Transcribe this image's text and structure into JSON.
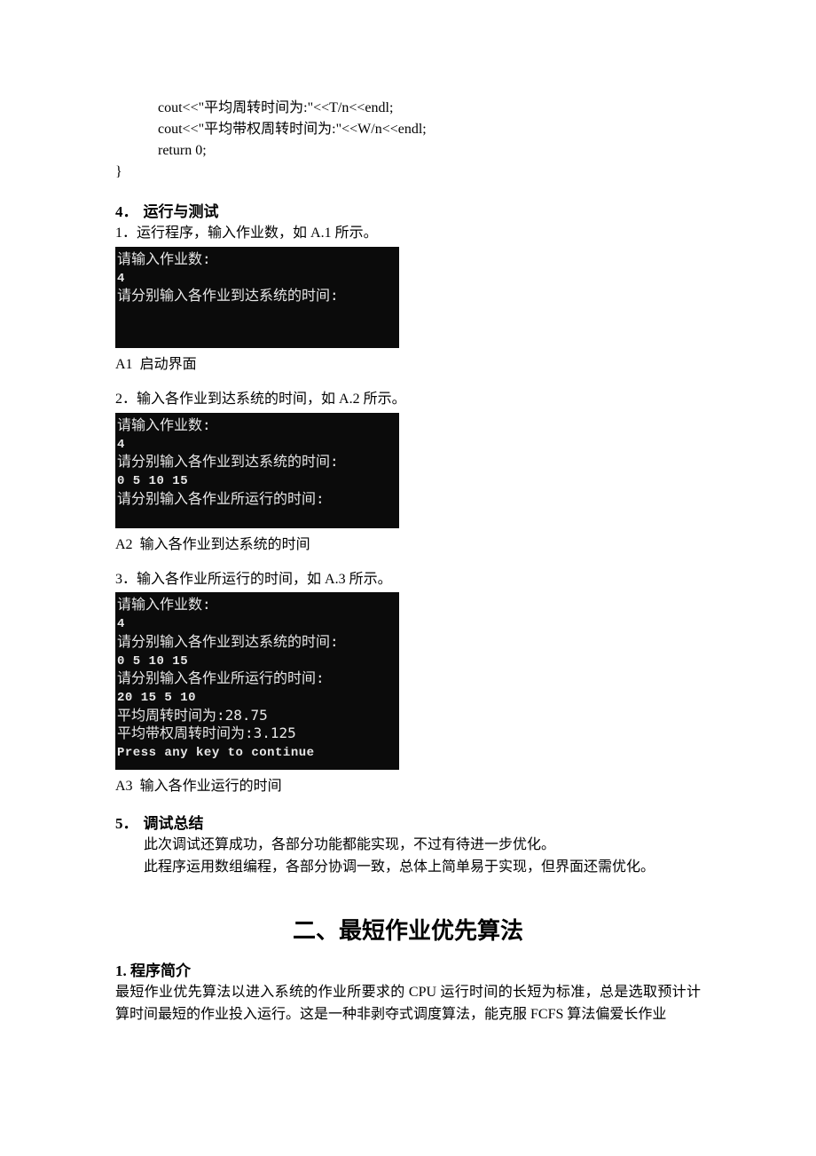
{
  "code": {
    "line1": "cout<<\"平均周转时间为:\"<<T/n<<endl;",
    "line2": "cout<<\"平均带权周转时间为:\"<<W/n<<endl;",
    "line3": "return 0;",
    "brace": "}"
  },
  "section4": {
    "heading_num": "4．",
    "heading": "运行与测试",
    "item1_num": "1．",
    "item1": "运行程序，输入作业数，如 A.1 所示。",
    "caption1_label": "A1",
    "caption1": "启动界面",
    "item2_num": "2．",
    "item2": "输入各作业到达系统的时间，如 A.2 所示。",
    "caption2_label": "A2",
    "caption2": "输入各作业到达系统的时间",
    "item3_num": "3．",
    "item3": "输入各作业所运行的时间，如 A.3 所示。",
    "caption3_label": "A3",
    "caption3": "输入各作业运行的时间"
  },
  "terminal1": {
    "l1": "请输入作业数:",
    "l2": "4",
    "l3": "请分别输入各作业到达系统的时间:"
  },
  "terminal2": {
    "l1": "请输入作业数:",
    "l2": "4",
    "l3": "请分别输入各作业到达系统的时间:",
    "l4": "0 5 10 15",
    "l5": "请分别输入各作业所运行的时间:"
  },
  "terminal3": {
    "l1": "请输入作业数:",
    "l2": "4",
    "l3": "请分别输入各作业到达系统的时间:",
    "l4": "0 5 10 15",
    "l5": "请分别输入各作业所运行的时间:",
    "l6": "20 15 5 10",
    "l7": "平均周转时间为:28.75",
    "l8": "平均带权周转时间为:3.125",
    "l9": "Press any key to continue"
  },
  "section5": {
    "heading_num": "5．",
    "heading": "调试总结",
    "p1": "此次调试还算成功，各部分功能都能实现，不过有待进一步优化。",
    "p2": "此程序运用数组编程，各部分协调一致，总体上简单易于实现，但界面还需优化。"
  },
  "part2": {
    "title": "二、最短作业优先算法",
    "heading_num": "1.",
    "heading": " 程序简介",
    "body": "最短作业优先算法以进入系统的作业所要求的 CPU 运行时间的长短为标准，总是选取预计计算时间最短的作业投入运行。这是一种非剥夺式调度算法，能克服 FCFS 算法偏爱长作业"
  }
}
